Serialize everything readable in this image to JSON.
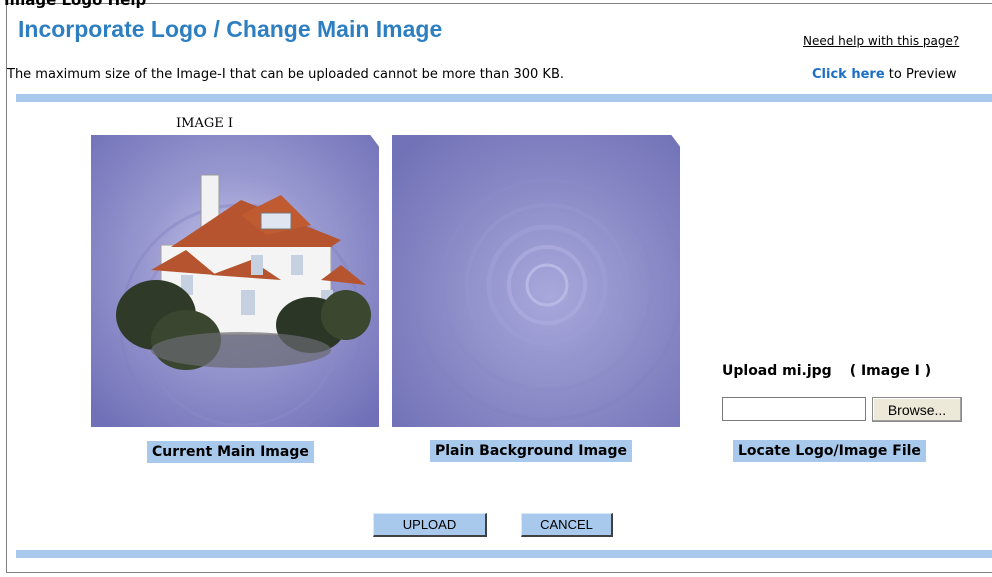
{
  "header": {
    "top_cut_text": "Image Logo Help",
    "title": "Incorporate Logo / Change Main Image",
    "help_link": "Need help with this page?",
    "max_size_text": "The maximum size of the Image-I that can be uploaded cannot be more than 300 KB.",
    "preview_link": "Click here",
    "preview_suffix": " to Preview"
  },
  "images": {
    "label": "IMAGE I",
    "current_caption": "Current Main Image",
    "plain_caption": "Plain Background Image"
  },
  "upload": {
    "label": "Upload mi.jpg",
    "label_sub": "( Image I )",
    "file_value": "",
    "browse_label": "Browse...",
    "locate_caption": "Locate Logo/Image File"
  },
  "actions": {
    "upload_label": "UPLOAD",
    "cancel_label": "CANCEL"
  },
  "colors": {
    "title": "#2e7fc1",
    "link": "#1a6fc4",
    "bar": "#a8c8ec",
    "image_bg": "#7f7fc0"
  }
}
